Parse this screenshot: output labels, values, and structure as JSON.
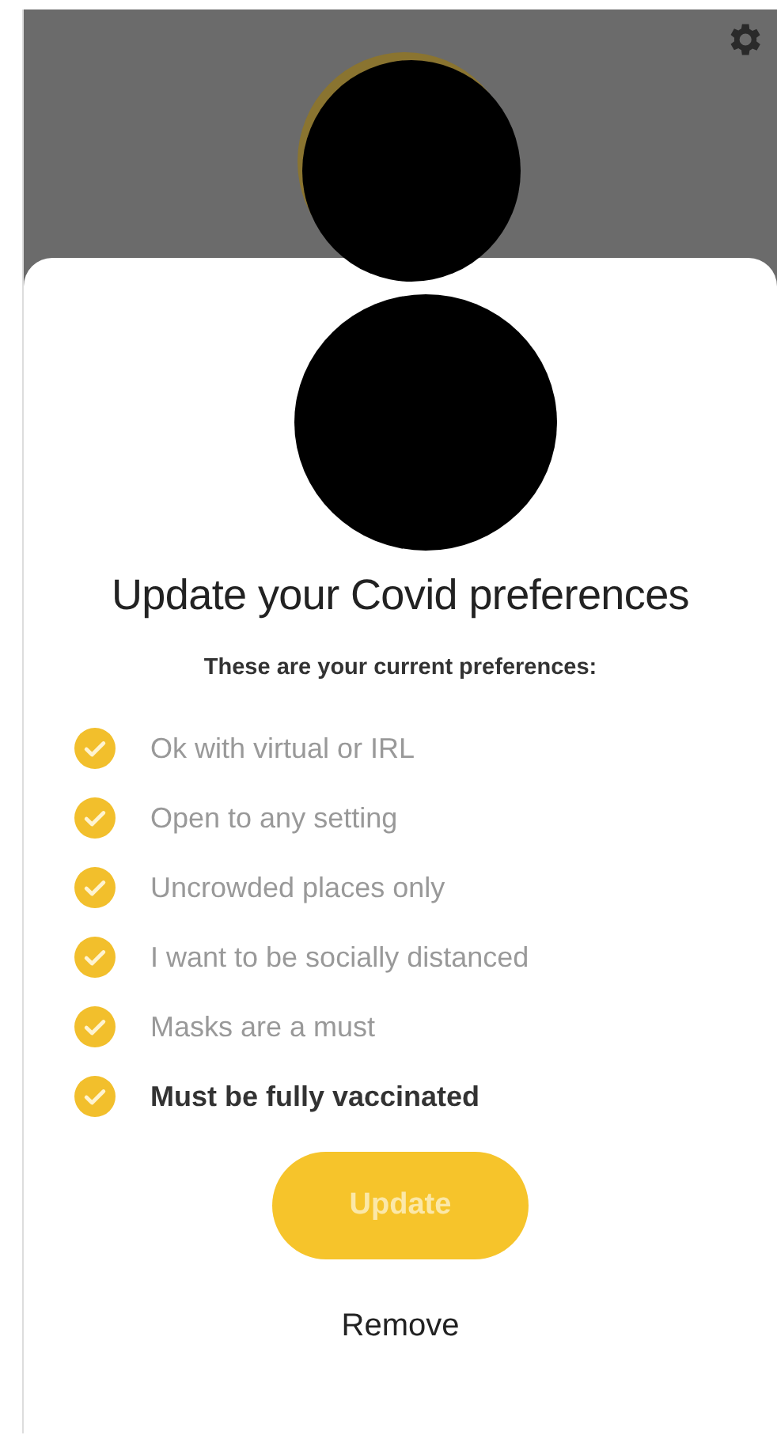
{
  "title": "Update your Covid preferences",
  "subtitle": "These are your current preferences:",
  "preferences": [
    {
      "label": "Ok with virtual or IRL",
      "bold": false
    },
    {
      "label": "Open to any setting",
      "bold": false
    },
    {
      "label": "Uncrowded places only",
      "bold": false
    },
    {
      "label": "I want to be socially distanced",
      "bold": false
    },
    {
      "label": "Masks are a must",
      "bold": false
    },
    {
      "label": "Must be fully vaccinated",
      "bold": true
    }
  ],
  "primary_button": "Update",
  "secondary_button": "Remove"
}
